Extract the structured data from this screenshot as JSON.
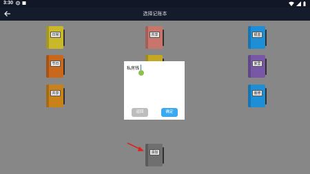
{
  "status": {
    "time": "3:30"
  },
  "app": {
    "title": "选择记账本"
  },
  "books": [
    {
      "label": "日常",
      "color": "#c9b92a"
    },
    {
      "label": "共享",
      "color": "#c8756c"
    },
    {
      "label": "银蓝",
      "color": "#1e8fd6"
    },
    {
      "label": "节日",
      "color": "#c9681a"
    },
    {
      "label": "",
      "color": "#c4a821"
    },
    {
      "label": "家里",
      "color": "#7757a6"
    },
    {
      "label": "共享",
      "color": "#c9821a"
    },
    {
      "label": "",
      "color": "#c4a821"
    },
    {
      "label": "装修",
      "color": "#1e8fd6"
    },
    {
      "label": "添加",
      "color": "#6f6f6f"
    }
  ],
  "dialog": {
    "input_value": "私房钱",
    "cancel_label": "返回",
    "confirm_label": "确定"
  },
  "colors": {
    "status_bar": "#111725",
    "app_bar": "#141b2b",
    "overlay": "#878787",
    "confirm": "#3ba9ef",
    "cancel": "#bdbdbd",
    "annotation_arrow": "#e02020"
  }
}
